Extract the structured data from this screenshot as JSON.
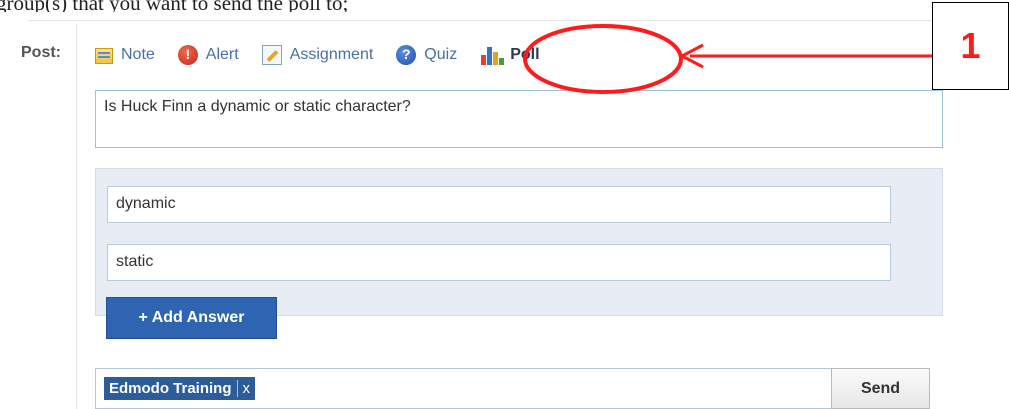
{
  "caption": "group(s) that you want to send the poll to;",
  "post_label": "Post:",
  "post_types": [
    {
      "label": "Note",
      "icon": "note-icon"
    },
    {
      "label": "Alert",
      "icon": "alert-icon"
    },
    {
      "label": "Assignment",
      "icon": "assignment-icon"
    },
    {
      "label": "Quiz",
      "icon": "quiz-icon"
    },
    {
      "label": "Poll",
      "icon": "poll-icon",
      "active": true
    }
  ],
  "question": "Is Huck Finn a dynamic or static character?",
  "answers": [
    "dynamic",
    "static"
  ],
  "add_answer_label": "+ Add Answer",
  "recipient_tag": {
    "label": "Edmodo Training",
    "remove": "x"
  },
  "send_label": "Send",
  "annotation": {
    "number": "1",
    "color": "#ff1b1b"
  },
  "colors": {
    "primary_button": "#2f64b2",
    "tag": "#2d5c9c",
    "panel": "#e8edf5"
  }
}
